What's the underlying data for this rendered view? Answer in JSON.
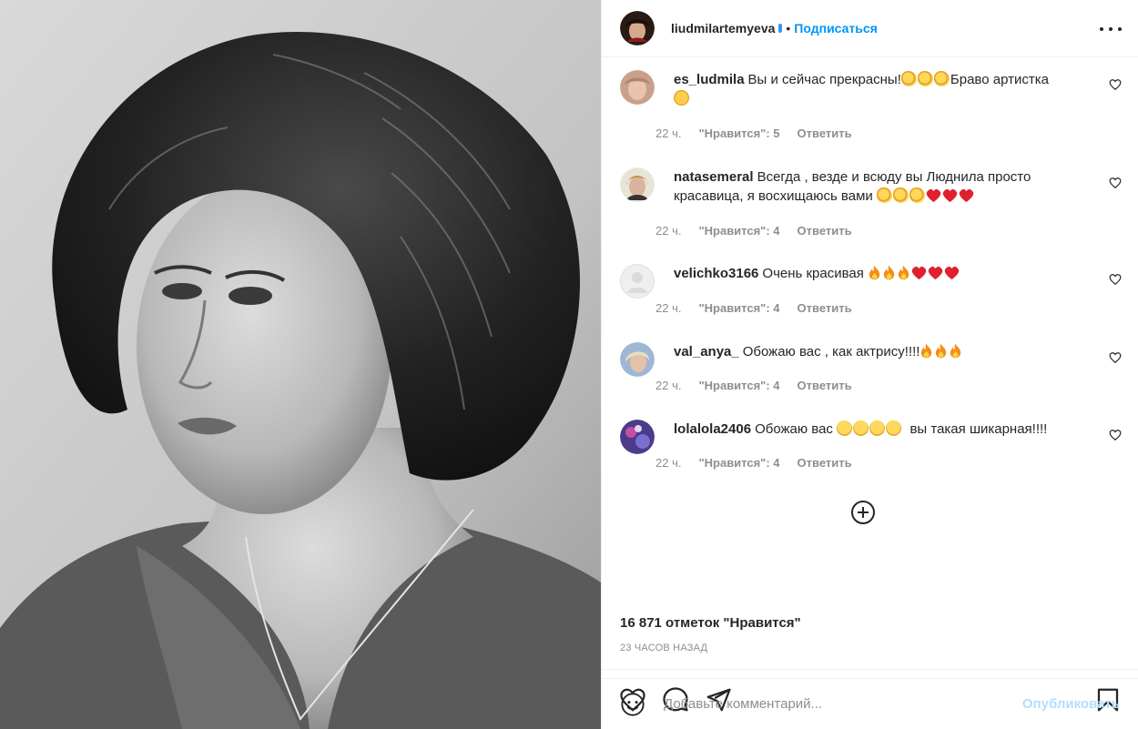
{
  "header": {
    "username": "liudmilartemyeva",
    "separator": "•",
    "follow_label": "Подписаться"
  },
  "comments": [
    {
      "username": "es_ludmila",
      "text": "Вы и сейчас прекрасны!",
      "emoji_after": [
        "clap",
        "clap",
        "clap"
      ],
      "text2": "Браво артистка",
      "emoji_line2": [
        "love"
      ],
      "time": "22 ч.",
      "likes": "\"Нравится\": 5",
      "reply": "Ответить"
    },
    {
      "username": "natasemeral",
      "text": "Всегда , везде и всюду вы Люднила просто красавица, я восхищаюсь вами",
      "emoji_after": [
        "clap",
        "clap",
        "clap",
        "heart",
        "heart",
        "heart"
      ],
      "time": "22 ч.",
      "likes": "\"Нравится\": 4",
      "reply": "Ответить"
    },
    {
      "username": "velichko3166",
      "text": "Очень красивая",
      "emoji_after": [
        "fire",
        "fire",
        "fire",
        "heart",
        "heart",
        "heart"
      ],
      "time": "22 ч.",
      "likes": "\"Нравится\": 4",
      "reply": "Ответить"
    },
    {
      "username": "val_anya_",
      "text": "Обожаю вас , как актрису!!!!",
      "emoji_after": [
        "fire",
        "fire",
        "fire"
      ],
      "time": "22 ч.",
      "likes": "\"Нравится\": 4",
      "reply": "Ответить"
    },
    {
      "username": "lolalola2406",
      "text": "Обожаю вас",
      "emoji_after": [
        "sad",
        "sad",
        "sad",
        "sad"
      ],
      "text2": "вы такая шикарная!!!!",
      "time": "22 ч.",
      "likes": "\"Нравится\": 4",
      "reply": "Ответить"
    }
  ],
  "likes_count": "16 871 отметок \"Нравится\"",
  "time_ago": "23 ЧАСОВ НАЗАД",
  "add_comment": {
    "placeholder": "Добавьте комментарий...",
    "post_label": "Опубликовать"
  },
  "icons": {
    "more": "more-options-icon",
    "heart": "heart-icon",
    "comment": "comment-icon",
    "share": "share-icon",
    "save": "bookmark-icon",
    "load_more": "plus-circle-icon",
    "emoji": "smile-icon"
  },
  "colors": {
    "link_blue": "#0095f6",
    "post_disabled": "#b2dffc",
    "meta_gray": "#8e8e8e",
    "divider": "#efefef"
  }
}
